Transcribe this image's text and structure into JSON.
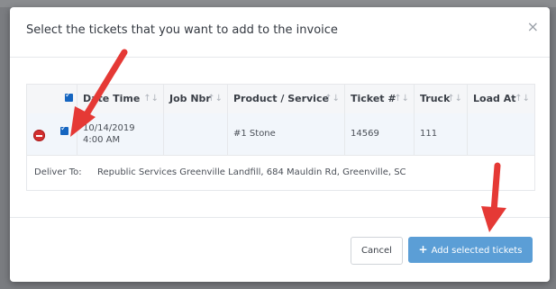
{
  "modal": {
    "title": "Select the tickets that you want to add to the invoice",
    "close_icon": "×"
  },
  "table": {
    "columns": [
      {
        "label": "Date Time",
        "sort_icon": "↑↓"
      },
      {
        "label": "Job Nbr",
        "sort_icon": "↑↓"
      },
      {
        "label": "Product / Service",
        "sort_icon": "↑↓"
      },
      {
        "label": "Ticket #",
        "sort_icon": "↑↓"
      },
      {
        "label": "Truck",
        "sort_icon": "↑↓"
      },
      {
        "label": "Load At",
        "sort_icon": "↑↓"
      }
    ],
    "rows": [
      {
        "date": "10/14/2019",
        "time": "4:00 AM",
        "job_nbr": "",
        "product": "#1 Stone",
        "ticket": "14569",
        "truck": "111",
        "load_at": "",
        "checked": true
      }
    ],
    "deliver_label": "Deliver To:",
    "deliver_value": "Republic Services Greenville Landfill, 684 Mauldin Rd, Greenville, SC"
  },
  "footer": {
    "cancel_label": "Cancel",
    "add_label": "Add selected tickets",
    "add_icon": "+"
  },
  "colors": {
    "accent": "#5b9ed6",
    "checkbox": "#1565c0",
    "remove": "#d32f2f",
    "arrow": "#e53935"
  }
}
